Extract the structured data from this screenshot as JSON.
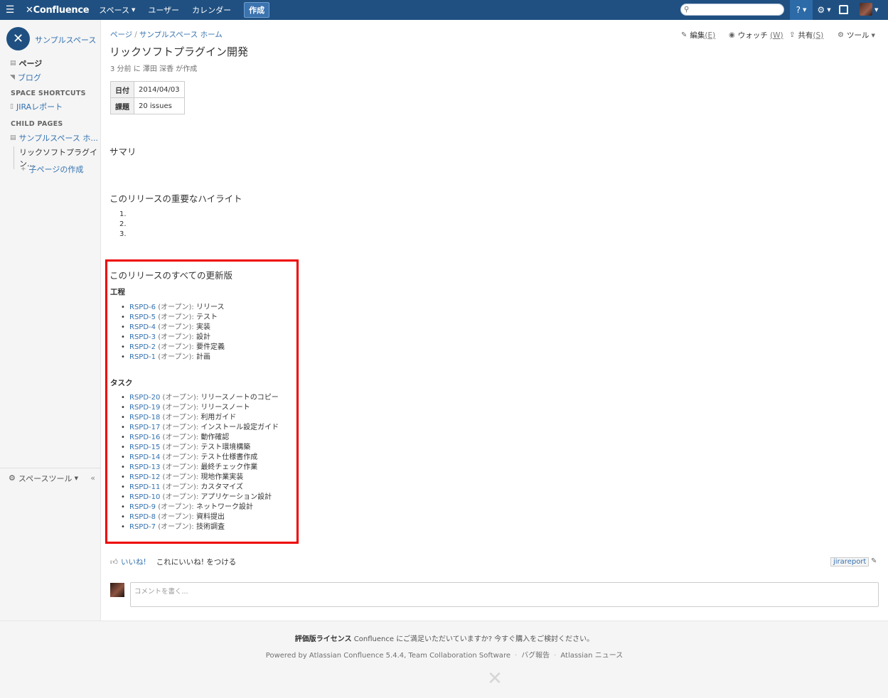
{
  "topbar": {
    "logo": "Confluence",
    "nav": [
      "スペース",
      "ユーザー",
      "カレンダー"
    ],
    "create_label": "作成",
    "search_placeholder": ""
  },
  "sidebar": {
    "space_name": "サンプルスペース",
    "pages_label": "ページ",
    "blog_label": "ブログ",
    "shortcuts_heading": "SPACE SHORTCUTS",
    "shortcut_jira": "JIRAレポート",
    "child_heading": "CHILD PAGES",
    "child_parent": "サンプルスペース ホ...",
    "child_current": "リックソフトプラグイン...",
    "add_child": "子ページの作成",
    "space_tools": "スペースツール",
    "collapse": "«"
  },
  "breadcrumb": [
    "ページ",
    "サンプルスペース ホーム"
  ],
  "actions": {
    "edit": "編集",
    "edit_key": "(E)",
    "watch": "ウォッチ",
    "watch_key": "(W)",
    "share": "共有",
    "share_key": "(S)",
    "tools": "ツール"
  },
  "page": {
    "title": "リックソフトプラグイン開発",
    "byline": "3 分前 に 澤田 深香 が作成",
    "meta": [
      {
        "label": "日付",
        "value": "2014/04/03"
      },
      {
        "label": "課題",
        "value": "20 issues"
      }
    ],
    "summary_heading": "サマリ",
    "highlights_heading": "このリリースの重要なハイライト",
    "highlights": [
      "1.",
      "2.",
      "3."
    ],
    "updates_heading": "このリリースのすべての更新版",
    "section1_heading": "工程",
    "section1_items": [
      {
        "key": "RSPD-6",
        "status": "(オープン):",
        "summary": "リリース"
      },
      {
        "key": "RSPD-5",
        "status": "(オープン):",
        "summary": "テスト"
      },
      {
        "key": "RSPD-4",
        "status": "(オープン):",
        "summary": "実装"
      },
      {
        "key": "RSPD-3",
        "status": "(オープン):",
        "summary": "設計"
      },
      {
        "key": "RSPD-2",
        "status": "(オープン):",
        "summary": "要件定義"
      },
      {
        "key": "RSPD-1",
        "status": "(オープン):",
        "summary": "計画"
      }
    ],
    "section2_heading": "タスク",
    "section2_items": [
      {
        "key": "RSPD-20",
        "status": "(オープン):",
        "summary": "リリースノートのコピー"
      },
      {
        "key": "RSPD-19",
        "status": "(オープン):",
        "summary": "リリースノート"
      },
      {
        "key": "RSPD-18",
        "status": "(オープン):",
        "summary": "利用ガイド"
      },
      {
        "key": "RSPD-17",
        "status": "(オープン):",
        "summary": "インストール設定ガイド"
      },
      {
        "key": "RSPD-16",
        "status": "(オープン):",
        "summary": "動作確認"
      },
      {
        "key": "RSPD-15",
        "status": "(オープン):",
        "summary": "テスト環境構築"
      },
      {
        "key": "RSPD-14",
        "status": "(オープン):",
        "summary": "テスト仕様書作成"
      },
      {
        "key": "RSPD-13",
        "status": "(オープン):",
        "summary": "最終チェック作業"
      },
      {
        "key": "RSPD-12",
        "status": "(オープン):",
        "summary": "現地作業実装"
      },
      {
        "key": "RSPD-11",
        "status": "(オープン):",
        "summary": "カスタマイズ"
      },
      {
        "key": "RSPD-10",
        "status": "(オープン):",
        "summary": "アプリケーション設計"
      },
      {
        "key": "RSPD-9",
        "status": "(オープン):",
        "summary": "ネットワーク設計"
      },
      {
        "key": "RSPD-8",
        "status": "(オープン):",
        "summary": "資料提出"
      },
      {
        "key": "RSPD-7",
        "status": "(オープン):",
        "summary": "技術調査"
      }
    ]
  },
  "like": {
    "link": "いいね!",
    "text": "これにいいね! をつける"
  },
  "label_tag": "jirareport",
  "comment_placeholder": "コメントを書く...",
  "footer": {
    "license_bold": "評価版ライセンス",
    "license_text": "Confluence にご満足いただいていますか? 今すぐ購入をご検討ください。",
    "powered": "Powered by Atlassian Confluence 5.4.4, Team Collaboration Software",
    "bug": "バグ報告",
    "news": "Atlassian ニュース"
  },
  "colors": {
    "topbar": "#205081",
    "link": "#3572b0",
    "highlight": "#ee0000"
  }
}
